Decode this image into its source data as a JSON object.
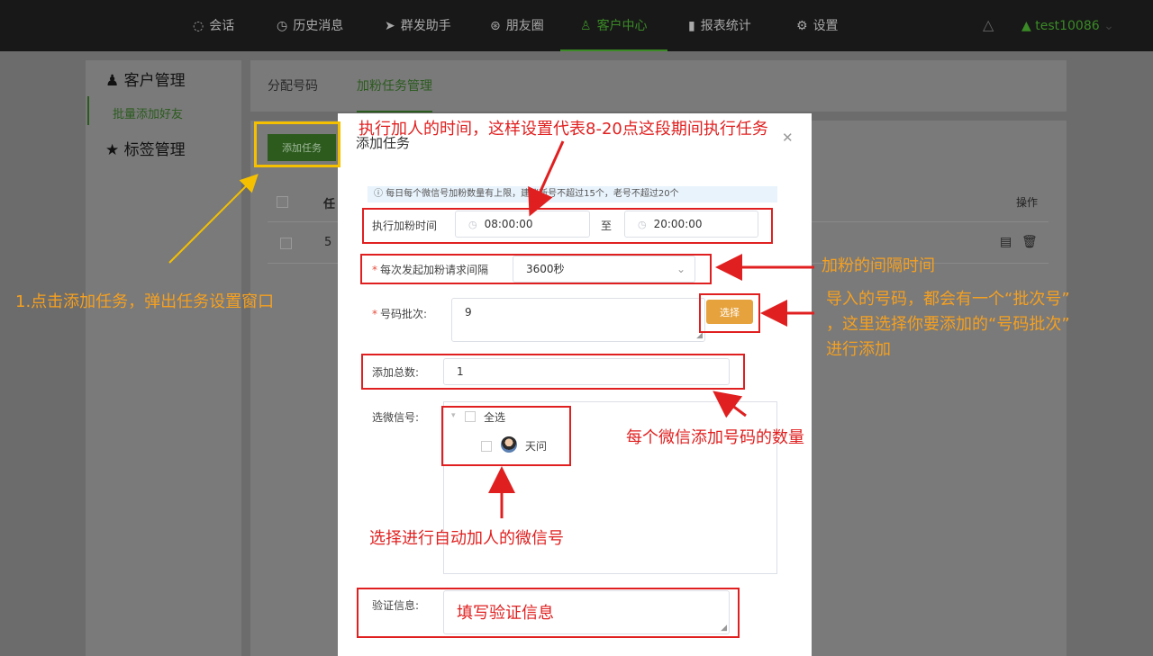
{
  "nav": {
    "items": [
      {
        "label": "会话",
        "icon": "chat-icon"
      },
      {
        "label": "历史消息",
        "icon": "clock-icon"
      },
      {
        "label": "群发助手",
        "icon": "send-icon"
      },
      {
        "label": "朋友圈",
        "icon": "aperture-icon"
      },
      {
        "label": "客户中心",
        "icon": "user-icon",
        "active": true
      },
      {
        "label": "报表统计",
        "icon": "bar-chart-icon"
      },
      {
        "label": "设置",
        "icon": "gear-icon"
      }
    ],
    "username": "test10086"
  },
  "sidebar": {
    "customer_mgmt": "客户管理",
    "batch_add": "批量添加好友",
    "tag_mgmt": "标签管理"
  },
  "tabs": [
    "分配号码",
    "加粉任务管理"
  ],
  "main": {
    "add_task_btn": "添加任务",
    "col_task": "任",
    "col_action": "操作",
    "row_id": "5"
  },
  "modal": {
    "title": "添加任务",
    "tip": "每日每个微信号加粉数量有上限，建议新号不超过15个，老号不超过20个",
    "exec_time_label": "执行加粉时间",
    "start_time": "08:00:00",
    "to": "至",
    "end_time": "20:00:00",
    "interval_label": "每次发起加粉请求间隔",
    "interval_value": "3600秒",
    "batch_label": "号码批次:",
    "batch_value": "9",
    "choose_btn": "选择",
    "total_label": "添加总数:",
    "total_value": "1",
    "wechat_label": "选微信号:",
    "select_all": "全选",
    "wechat_account": "天问",
    "verify_label": "验证信息:",
    "verify_value": "填写验证信息"
  },
  "annotations": {
    "time_note": "执行加人的时间，这样设置代表8-20点这段期间执行任务",
    "interval_note": "加粉的间隔时间",
    "batch_note_1": "导入的号码，都会有一个“批次号”",
    "batch_note_2": "，这里选择你要添加的“号码批次”",
    "batch_note_3": "进行添加",
    "total_note": "每个微信添加号码的数量",
    "wechat_note": "选择进行自动加人的微信号",
    "step1_note": "1.点击添加任务，弹出任务设置窗口"
  },
  "colors": {
    "accent": "#3a8a26",
    "annotation_red": "#e02020",
    "annotation_orange": "#f5a020",
    "choose_btn": "#e6a23c"
  }
}
